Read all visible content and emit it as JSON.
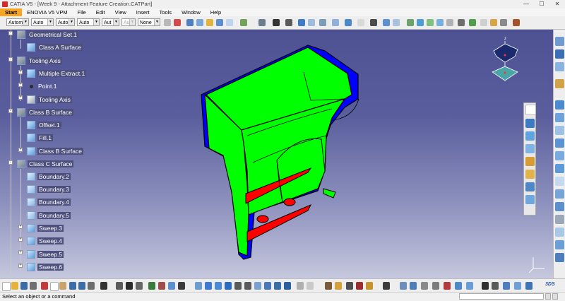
{
  "window": {
    "title": "CATIA V5 - [Week 9 - Attachment Feature Creation.CATPart]",
    "minimize": "—",
    "maximize": "☐",
    "close": "✕"
  },
  "menu": [
    {
      "label": "Start"
    },
    {
      "label": "ENOVIA V5 VPM"
    },
    {
      "label": "File"
    },
    {
      "label": "Edit"
    },
    {
      "label": "View"
    },
    {
      "label": "Insert"
    },
    {
      "label": "Tools"
    },
    {
      "label": "Window"
    },
    {
      "label": "Help"
    }
  ],
  "toolbar": {
    "combos": [
      {
        "value": "Autom..."
      },
      {
        "value": "Auto"
      },
      {
        "value": "Auto"
      },
      {
        "value": "Auto"
      },
      {
        "value": "Aut"
      },
      {
        "value": "Aut"
      },
      {
        "value": "None"
      }
    ]
  },
  "tree": {
    "items": [
      {
        "label": "Geometrical Set.1",
        "icon": "geometrical-set-icon"
      },
      {
        "label": "Class A Surface",
        "icon": "surface-icon"
      },
      {
        "label": "Tooling Axis",
        "icon": "geometrical-set-icon"
      },
      {
        "label": "Multiple Extract.1",
        "icon": "extract-icon"
      },
      {
        "label": "Point.1",
        "icon": "point-icon"
      },
      {
        "label": "Tooling Axis",
        "icon": "line-icon"
      },
      {
        "label": "Class B Surface",
        "icon": "geometrical-set-icon"
      },
      {
        "label": "Offset.1",
        "icon": "offset-icon"
      },
      {
        "label": "Fill.1",
        "icon": "fill-icon"
      },
      {
        "label": "Class B Surface",
        "icon": "join-icon"
      },
      {
        "label": "Class C Surface",
        "icon": "geometrical-set-icon"
      },
      {
        "label": "Boundary.2",
        "icon": "boundary-icon"
      },
      {
        "label": "Boundary.3",
        "icon": "boundary-icon"
      },
      {
        "label": "Boundary.4",
        "icon": "boundary-icon"
      },
      {
        "label": "Boundary.5",
        "icon": "boundary-icon"
      },
      {
        "label": "Sweep.3",
        "icon": "sweep-icon"
      },
      {
        "label": "Sweep.4",
        "icon": "sweep-icon"
      },
      {
        "label": "Sweep.5",
        "icon": "sweep-icon"
      },
      {
        "label": "Sweep.6",
        "icon": "sweep-icon"
      }
    ]
  },
  "compass": {
    "z_label": "z"
  },
  "model": {
    "colors": {
      "class_a": "#00ff00",
      "class_b": "#ff0000",
      "class_c": "#0000ff",
      "edges": "#000000"
    }
  },
  "viewport": {
    "bg_top": "#4e5293",
    "bg_bottom": "#c6c8de"
  },
  "status": {
    "message": "Select an object or a command"
  }
}
